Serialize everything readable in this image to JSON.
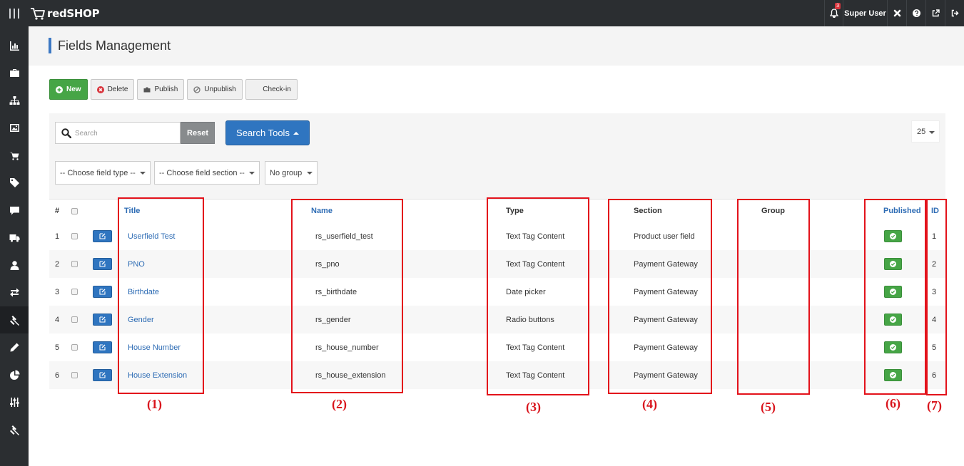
{
  "app": {
    "logo_text": "redSHOP"
  },
  "topbar": {
    "notification_count": "3",
    "user_label": "Super User",
    "icons": [
      "bell-icon",
      "joomla-icon",
      "help-icon",
      "external-link-icon",
      "logout-icon"
    ]
  },
  "sidebar": {
    "icons": [
      "bar-chart-icon",
      "briefcase-icon",
      "sitemap-icon",
      "image-icon",
      "cart-icon",
      "tag-icon",
      "comment-icon",
      "truck-icon",
      "user-icon",
      "exchange-icon",
      "gavel-icon",
      "pencil-icon",
      "pie-chart-icon",
      "sliders-icon",
      "gavel-icon"
    ],
    "active_index": 10
  },
  "page": {
    "title": "Fields Management"
  },
  "toolbar": {
    "new_label": "New",
    "delete_label": "Delete",
    "publish_label": "Publish",
    "unpublish_label": "Unpublish",
    "checkin_label": "Check-in"
  },
  "filters": {
    "search_placeholder": "Search",
    "reset_label": "Reset",
    "search_tools_label": "Search Tools",
    "limit_value": "25",
    "field_type": "-- Choose field type --",
    "field_section": "-- Choose field section --",
    "group": "No group"
  },
  "table": {
    "headers": {
      "num": "#",
      "title": "Title",
      "name": "Name",
      "type": "Type",
      "section": "Section",
      "group": "Group",
      "published": "Published",
      "id": "ID"
    },
    "rows": [
      {
        "num": "1",
        "title": "Userfield Test",
        "name": "rs_userfield_test",
        "type": "Text Tag Content",
        "section": "Product user field",
        "group": "",
        "published": true,
        "id": "1"
      },
      {
        "num": "2",
        "title": "PNO",
        "name": "rs_pno",
        "type": "Text Tag Content",
        "section": "Payment Gateway",
        "group": "",
        "published": true,
        "id": "2"
      },
      {
        "num": "3",
        "title": "Birthdate",
        "name": "rs_birthdate",
        "type": "Date picker",
        "section": "Payment Gateway",
        "group": "",
        "published": true,
        "id": "3"
      },
      {
        "num": "4",
        "title": "Gender",
        "name": "rs_gender",
        "type": "Radio buttons",
        "section": "Payment Gateway",
        "group": "",
        "published": true,
        "id": "4"
      },
      {
        "num": "5",
        "title": "House Number",
        "name": "rs_house_number",
        "type": "Text Tag Content",
        "section": "Payment Gateway",
        "group": "",
        "published": true,
        "id": "5"
      },
      {
        "num": "6",
        "title": "House Extension",
        "name": "rs_house_extension",
        "type": "Text Tag Content",
        "section": "Payment Gateway",
        "group": "",
        "published": true,
        "id": "6"
      }
    ]
  },
  "annotations": {
    "labels": [
      "(1)",
      "(2)",
      "(3)",
      "(4)",
      "(5)",
      "(6)",
      "(7)"
    ],
    "color": "#e3121b"
  },
  "colors": {
    "topbar_bg": "#2b2e31",
    "primary_blue": "#2f75c0",
    "success_green": "#46a546"
  }
}
